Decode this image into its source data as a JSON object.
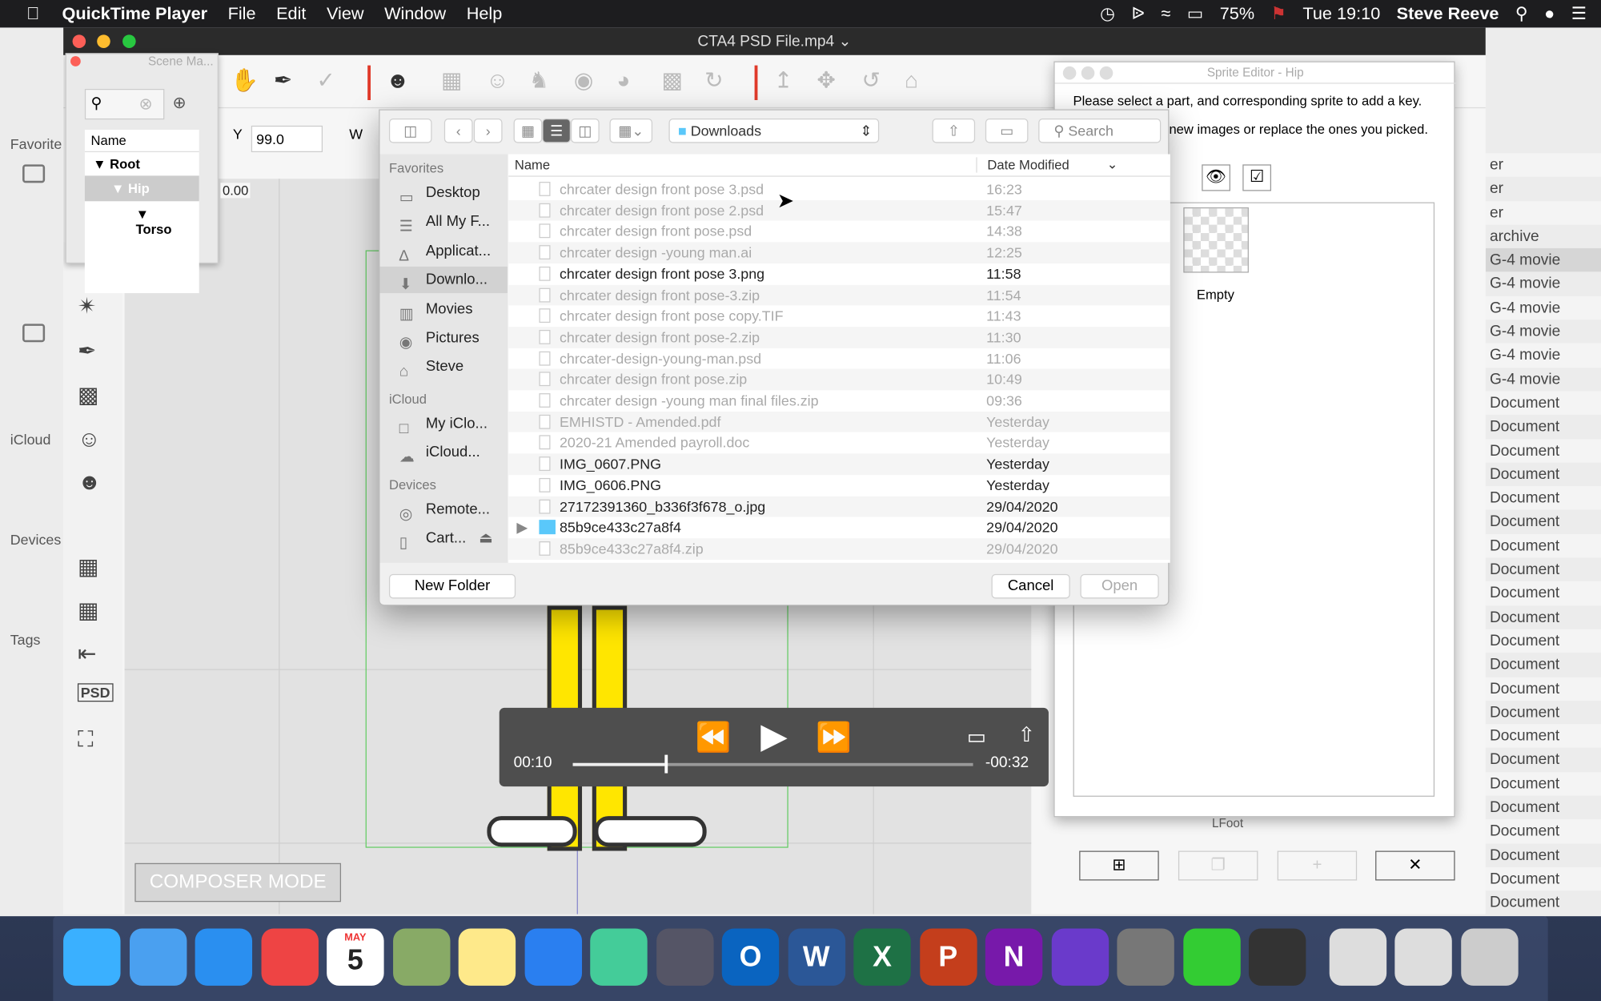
{
  "menubar": {
    "app": "QuickTime Player",
    "items": [
      "File",
      "Edit",
      "View",
      "Window",
      "Help"
    ],
    "battery": "75%",
    "clock": "Tue 19:10",
    "user": "Steve Reeve"
  },
  "finder_bg": {
    "sections": [
      "Favorite",
      "iCloud",
      "Devices",
      "Tags"
    ],
    "right_kinds": [
      "er",
      "er",
      "er",
      "archive",
      "G-4 movie",
      "G-4 movie",
      "G-4 movie",
      "G-4 movie",
      "G-4 movie",
      "G-4 movie",
      "Document",
      "Document",
      "Document",
      "Document",
      "Document",
      "Document",
      "Document",
      "Document",
      "Document",
      "Document",
      "Document",
      "Document",
      "Document",
      "Document",
      "Document",
      "Document",
      "Document",
      "Document",
      "Document",
      "Document",
      "Document",
      "Document"
    ]
  },
  "window": {
    "title": "CTA4 PSD File.mp4"
  },
  "scene_manager": {
    "title": "Scene Ma...",
    "column": "Name",
    "nodes": [
      "Root",
      "Hip",
      "Torso"
    ]
  },
  "props": {
    "y_label": "Y",
    "y_value": "99.0",
    "w_label": "W",
    "ruler_value": "0.00"
  },
  "composer": {
    "label": "COMPOSER MODE"
  },
  "video": {
    "elapsed": "00:10",
    "remaining": "-00:32",
    "progress": 0.23
  },
  "sprite_editor": {
    "title": "Sprite Editor - Hip",
    "line1": "Please select a part, and corresponding sprite to add a key.",
    "line2": "new images or replace the ones you picked.",
    "sprite_label": "Empty",
    "part_label": "LFoot"
  },
  "dialog": {
    "location": "Downloads",
    "search_placeholder": "Search",
    "sidebar": {
      "favorites_header": "Favorites",
      "favorites": [
        "Desktop",
        "All My F...",
        "Applicat...",
        "Downlo...",
        "Movies",
        "Pictures",
        "Steve"
      ],
      "icloud_header": "iCloud",
      "icloud": [
        "My iClo...",
        "iCloud..."
      ],
      "devices_header": "Devices",
      "devices": [
        "Remote...",
        "Cart..."
      ]
    },
    "columns": {
      "name": "Name",
      "date": "Date Modified"
    },
    "files": [
      {
        "name": "chrcater design front pose 3.psd",
        "date": "16:23",
        "enabled": false
      },
      {
        "name": "chrcater design front pose 2.psd",
        "date": "15:47",
        "enabled": false
      },
      {
        "name": "chrcater design front pose.psd",
        "date": "14:38",
        "enabled": false
      },
      {
        "name": "chrcater design -young man.ai",
        "date": "12:25",
        "enabled": false
      },
      {
        "name": "chrcater design front pose 3.png",
        "date": "11:58",
        "enabled": true
      },
      {
        "name": "chrcater design front pose-3.zip",
        "date": "11:54",
        "enabled": false
      },
      {
        "name": "chrcater design front pose copy.TIF",
        "date": "11:43",
        "enabled": false
      },
      {
        "name": "chrcater design front pose-2.zip",
        "date": "11:30",
        "enabled": false
      },
      {
        "name": "chrcater-design-young-man.psd",
        "date": "11:06",
        "enabled": false
      },
      {
        "name": "chrcater design front pose.zip",
        "date": "10:49",
        "enabled": false
      },
      {
        "name": "chrcater design -young man final files.zip",
        "date": "09:36",
        "enabled": false
      },
      {
        "name": "EMHISTD - Amended.pdf",
        "date": "Yesterday",
        "enabled": false
      },
      {
        "name": "2020-21 Amended payroll.doc",
        "date": "Yesterday",
        "enabled": false
      },
      {
        "name": "IMG_0607.PNG",
        "date": "Yesterday",
        "enabled": true
      },
      {
        "name": "IMG_0606.PNG",
        "date": "Yesterday",
        "enabled": true
      },
      {
        "name": "27172391360_b336f3f678_o.jpg",
        "date": "29/04/2020",
        "enabled": true
      },
      {
        "name": "85b9ce433c27a8f4",
        "date": "29/04/2020",
        "enabled": true,
        "folder": true
      },
      {
        "name": "85b9ce433c27a8f4.zip",
        "date": "29/04/2020",
        "enabled": false
      }
    ],
    "new_folder": "New Folder",
    "cancel": "Cancel",
    "open": "Open"
  },
  "dock": {
    "calendar_month": "MAY",
    "calendar_day": "5",
    "apps": [
      "Messages",
      "Finder",
      "Safari",
      "Chrome",
      "Calendar",
      "Preview",
      "Notes",
      "App Store",
      "Maps",
      "Launchpad",
      "Outlook",
      "Word",
      "Excel",
      "PowerPoint",
      "OneNote",
      "iMovie",
      "System Preferences",
      "Touch ID",
      "QuickTime",
      "Documents",
      "Documents",
      "Trash"
    ]
  }
}
